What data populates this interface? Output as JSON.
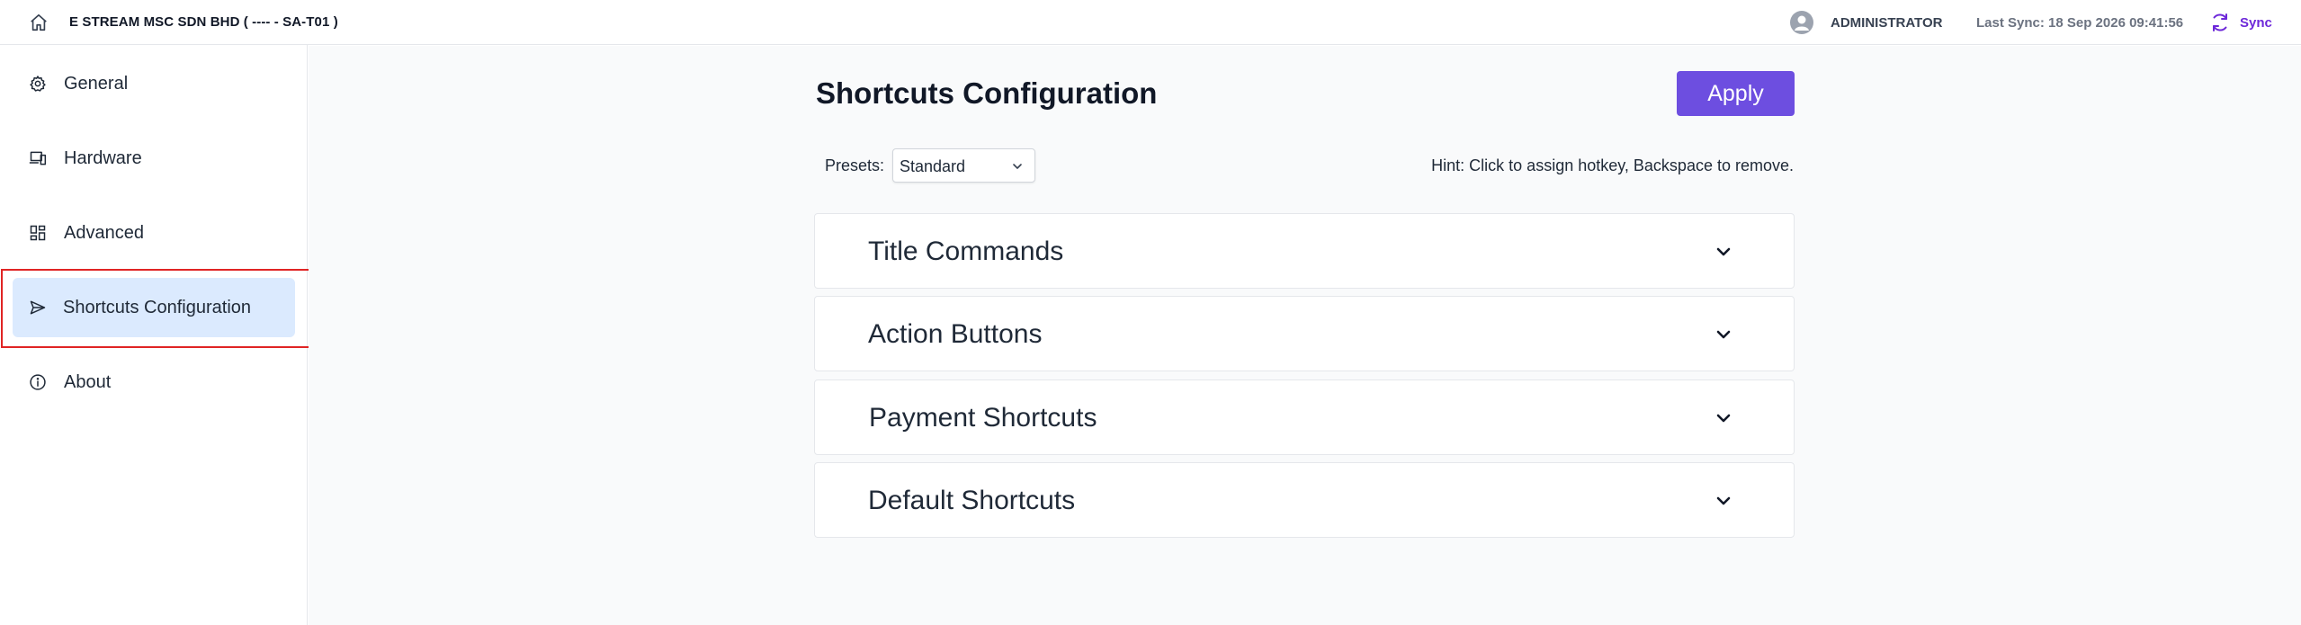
{
  "header": {
    "company": "E STREAM MSC SDN BHD ( ---- - SA-T01 )",
    "user": "ADMINISTRATOR",
    "last_sync": "Last Sync: 18 Sep 2026 09:41:56",
    "sync_label": "Sync"
  },
  "sidebar": {
    "items": [
      {
        "label": "General",
        "icon": "gear-icon"
      },
      {
        "label": "Hardware",
        "icon": "devices-icon"
      },
      {
        "label": "Advanced",
        "icon": "grid-icon"
      },
      {
        "label": "Shortcuts Configuration",
        "icon": "send-icon",
        "active": true
      },
      {
        "label": "About",
        "icon": "info-icon"
      }
    ]
  },
  "main": {
    "title": "Shortcuts Configuration",
    "apply_label": "Apply",
    "presets_label": "Presets:",
    "presets_value": "Standard",
    "hint": "Hint: Click to assign hotkey, Backspace to remove.",
    "sections": [
      {
        "title": "Title Commands"
      },
      {
        "title": "Action Buttons"
      },
      {
        "title": "Payment Shortcuts"
      },
      {
        "title": "Default Shortcuts"
      }
    ]
  },
  "colors": {
    "accent": "#6d4ee0",
    "sync": "#6d28d9",
    "active_nav": "#dbeafe",
    "highlight": "#e02424"
  }
}
